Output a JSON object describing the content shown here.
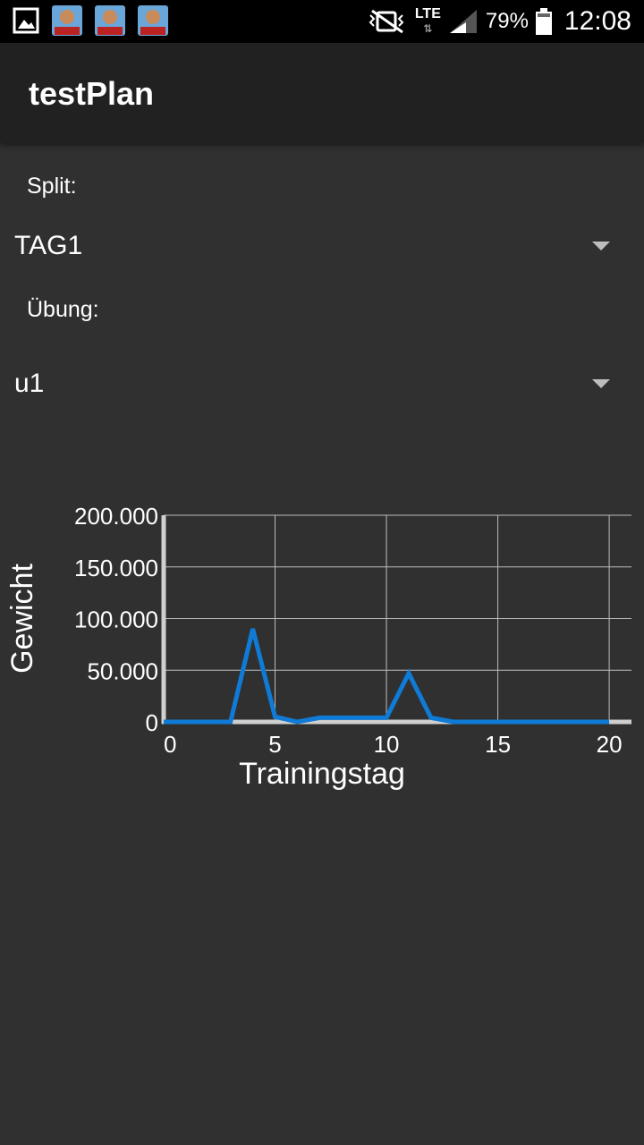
{
  "status_bar": {
    "battery_percent": "79%",
    "time": "12:08",
    "network": "LTE"
  },
  "app_bar": {
    "title": "testPlan"
  },
  "form": {
    "split_label": "Split:",
    "split_value": "TAG1",
    "exercise_label": "Übung:",
    "exercise_value": "u1"
  },
  "colors": {
    "background": "#303030",
    "app_bar": "#212121",
    "series_line": "#0f7bd6",
    "grid": "#bdbdbd"
  },
  "chart_data": {
    "type": "line",
    "xlabel": "Trainingstag",
    "ylabel": "Gewicht",
    "xlim": [
      0,
      21
    ],
    "ylim": [
      0,
      200000
    ],
    "x_ticks": [
      0,
      5,
      10,
      15,
      20
    ],
    "x_tick_labels": [
      "0",
      "5",
      "10",
      "15",
      "20"
    ],
    "y_ticks": [
      0,
      50000,
      100000,
      150000,
      200000
    ],
    "y_tick_labels": [
      "0",
      "50.000",
      "100.000",
      "150.000",
      "200.000"
    ],
    "grid": true,
    "series": [
      {
        "x": [
          0,
          1,
          2,
          3,
          4,
          5,
          6,
          7,
          8,
          9,
          10,
          11,
          12,
          13,
          14,
          15,
          16,
          17,
          18,
          19,
          20
        ],
        "y": [
          0,
          0,
          0,
          0,
          90000,
          5000,
          0,
          4000,
          4000,
          4000,
          4000,
          47000,
          4000,
          0,
          0,
          0,
          0,
          0,
          0,
          0,
          0
        ]
      }
    ]
  }
}
